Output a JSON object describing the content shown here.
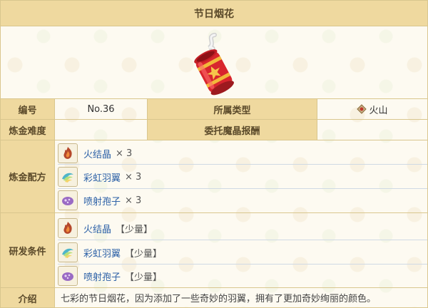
{
  "title": "节日烟花",
  "labels": {
    "number": "编号",
    "category": "所属类型",
    "difficulty": "炼金难度",
    "reward": "委托魔晶报酬",
    "recipe": "炼金配方",
    "research": "研发条件",
    "intro": "介绍"
  },
  "values": {
    "number": "No.36",
    "category": "火山",
    "difficulty": "",
    "reward": ""
  },
  "recipe": [
    {
      "name": "火结晶",
      "qty": "× 3"
    },
    {
      "name": "彩虹羽翼",
      "qty": "× 3"
    },
    {
      "name": "喷射孢子",
      "qty": "× 3"
    }
  ],
  "research": [
    {
      "name": "火结晶",
      "qty": "【少量】"
    },
    {
      "name": "彩虹羽翼",
      "qty": "【少量】"
    },
    {
      "name": "喷射孢子",
      "qty": "【少量】"
    }
  ],
  "description": "七彩的节日烟花，因为添加了一些奇妙的羽翼，拥有了更加奇妙绚丽的颜色。"
}
